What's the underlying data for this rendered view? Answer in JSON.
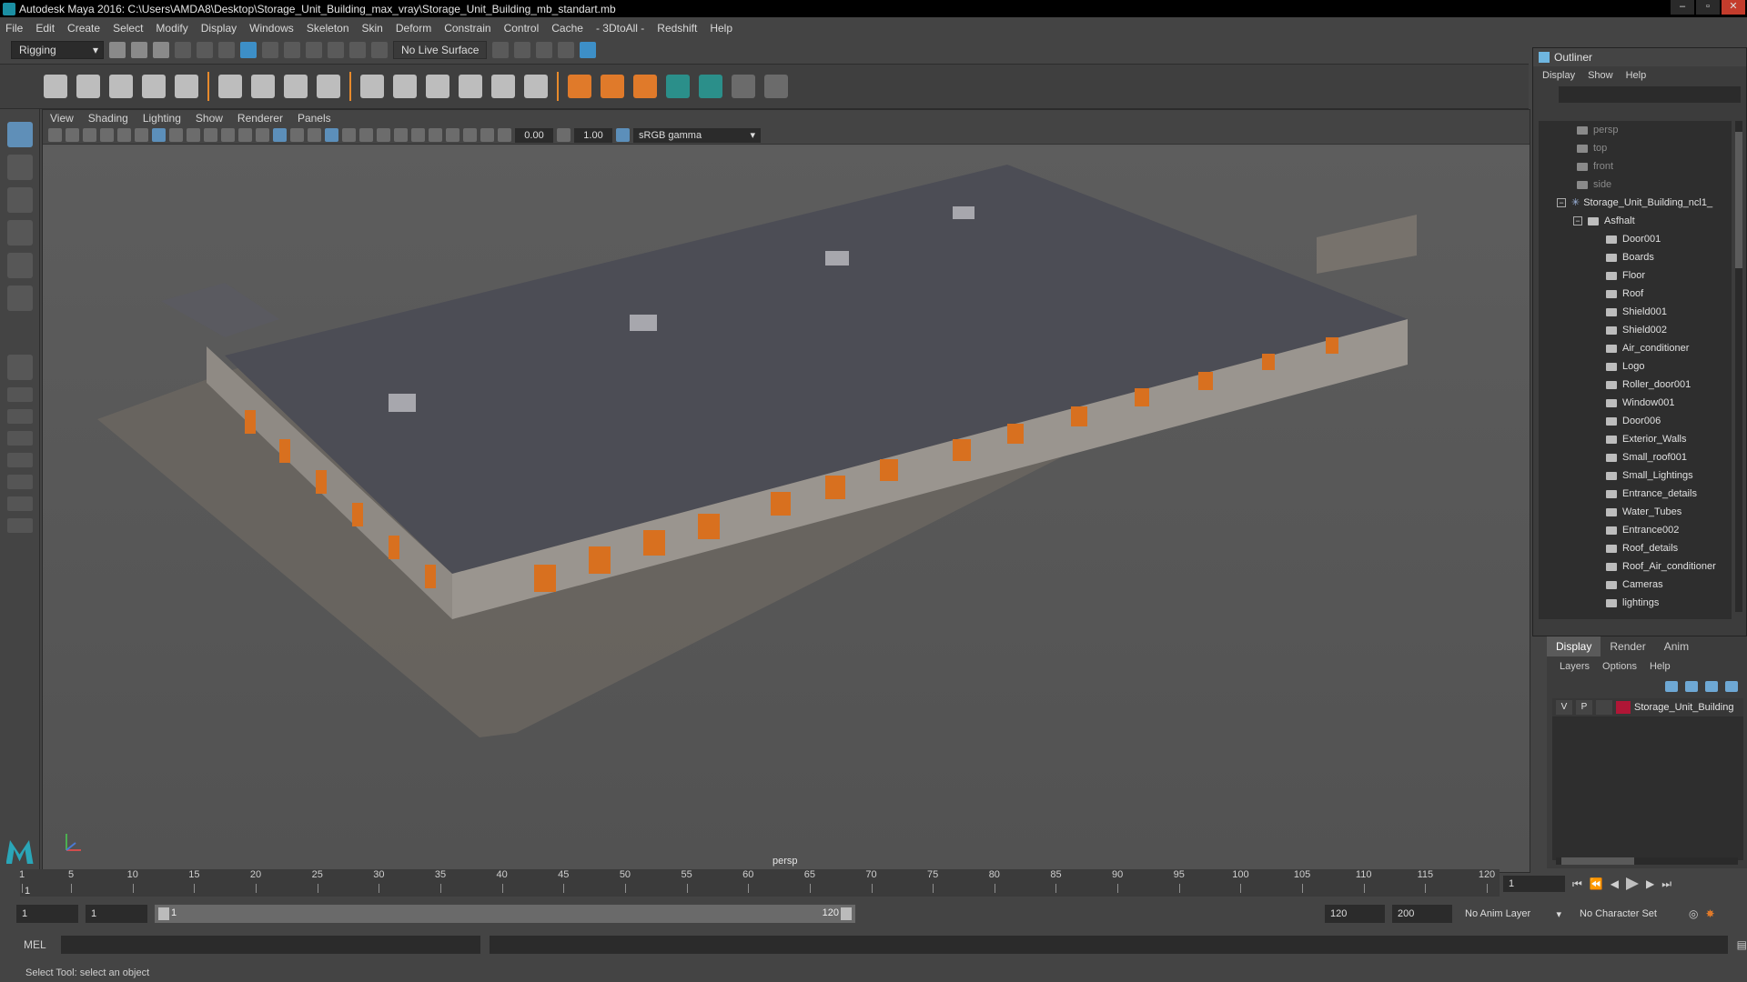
{
  "window": {
    "title": "Autodesk Maya 2016: C:\\Users\\AMDA8\\Desktop\\Storage_Unit_Building_max_vray\\Storage_Unit_Building_mb_standart.mb"
  },
  "menu": [
    "File",
    "Edit",
    "Create",
    "Select",
    "Modify",
    "Display",
    "Windows",
    "Skeleton",
    "Skin",
    "Deform",
    "Constrain",
    "Control",
    "Cache",
    "- 3DtoAll -",
    "Redshift",
    "Help"
  ],
  "statusline": {
    "mode": "Rigging",
    "live_surface": "No Live Surface"
  },
  "viewport": {
    "menu": [
      "View",
      "Shading",
      "Lighting",
      "Show",
      "Renderer",
      "Panels"
    ],
    "exposure": "0.00",
    "gamma": "1.00",
    "color_space": "sRGB gamma",
    "camera_label": "persp"
  },
  "outliner": {
    "title": "Outliner",
    "menu": [
      "Display",
      "Show",
      "Help"
    ],
    "cameras": [
      "persp",
      "top",
      "front",
      "side"
    ],
    "root": "Storage_Unit_Building_ncl1_",
    "group": "Asfhalt",
    "children": [
      "Door001",
      "Boards",
      "Floor",
      "Roof",
      "Shield001",
      "Shield002",
      "Air_conditioner",
      "Logo",
      "Roller_door001",
      "Window001",
      "Door006",
      "Exterior_Walls",
      "Small_roof001",
      "Small_Lightings",
      "Entrance_details",
      "Water_Tubes",
      "Entrance002",
      "Roof_details",
      "Roof_Air_conditioner",
      "Cameras",
      "lightings"
    ]
  },
  "layers": {
    "tabs": [
      "Display",
      "Render",
      "Anim"
    ],
    "menu": [
      "Layers",
      "Options",
      "Help"
    ],
    "row": {
      "v": "V",
      "p": "P",
      "name": "Storage_Unit_Building",
      "color": "#b01636"
    }
  },
  "timeline": {
    "ticks": [
      "1",
      "5",
      "10",
      "15",
      "20",
      "25",
      "30",
      "35",
      "40",
      "45",
      "50",
      "55",
      "60",
      "65",
      "70",
      "75",
      "80",
      "85",
      "90",
      "95",
      "100",
      "105",
      "110",
      "115",
      "120"
    ],
    "current_frame": "1",
    "current_field": "1"
  },
  "range": {
    "start": "1",
    "start_inner": "1",
    "bar_start": "1",
    "bar_end": "120",
    "end": "120",
    "end_outer": "200",
    "anim_layer": "No Anim Layer",
    "character_set": "No Character Set"
  },
  "command": {
    "label": "MEL",
    "help": "Select Tool: select an object"
  }
}
